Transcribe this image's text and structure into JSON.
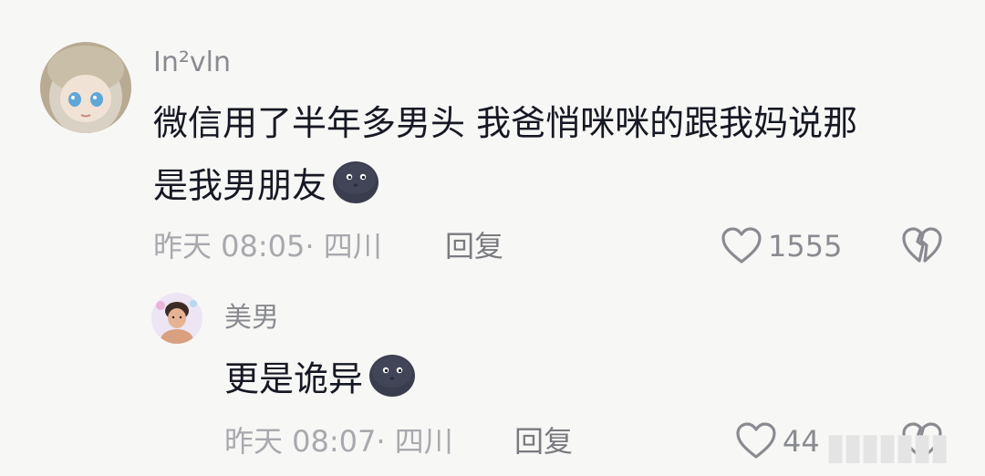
{
  "comment": {
    "username": "In²vln",
    "text_line1": "微信用了半年多男头 我爸悄咪咪的跟我妈说那",
    "text_line2": "是我男朋友",
    "emoji": "new-moon-face",
    "time": "昨天 08:05",
    "location": "· 四川",
    "reply_label": "回复",
    "like_count": "1555"
  },
  "reply": {
    "username": "美男",
    "text": "更是诡异",
    "emoji": "new-moon-face",
    "time": "昨天 08:07",
    "location": "· 四川",
    "reply_label": "回复",
    "like_count": "44"
  },
  "icons": {
    "like": "heart-outline-icon",
    "dislike": "broken-heart-icon"
  },
  "colors": {
    "background": "#f7f7f5",
    "text": "#161823",
    "muted": "#a8a9ae",
    "emoji": "#3a3d4e"
  }
}
